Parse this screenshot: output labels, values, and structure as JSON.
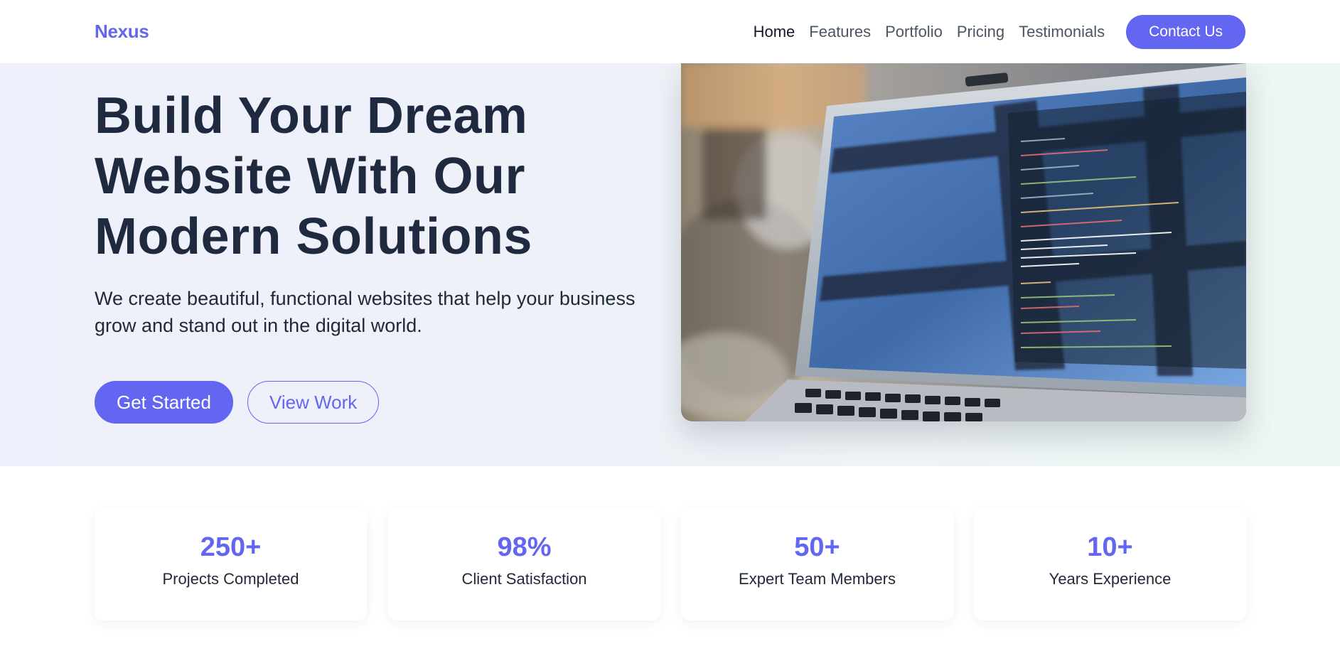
{
  "brand": {
    "name": "Nexus",
    "accent_color": "#6366f1"
  },
  "nav": {
    "links": [
      {
        "label": "Home",
        "active": true
      },
      {
        "label": "Features",
        "active": false
      },
      {
        "label": "Portfolio",
        "active": false
      },
      {
        "label": "Pricing",
        "active": false
      },
      {
        "label": "Testimonials",
        "active": false
      }
    ],
    "cta_label": "Contact Us"
  },
  "hero": {
    "title_lines": [
      "Build Your Dream",
      "Website With Our",
      "Modern Solutions"
    ],
    "subtitle": "We create beautiful, functional websites that help your business grow and stand out in the digital world.",
    "primary_button": "Get Started",
    "secondary_button": "View Work",
    "image_subject": "laptop with code editor"
  },
  "stats": [
    {
      "value": "250+",
      "label": "Projects Completed"
    },
    {
      "value": "98%",
      "label": "Client Satisfaction"
    },
    {
      "value": "50+",
      "label": "Expert Team Members"
    },
    {
      "value": "10+",
      "label": "Years Experience"
    }
  ]
}
